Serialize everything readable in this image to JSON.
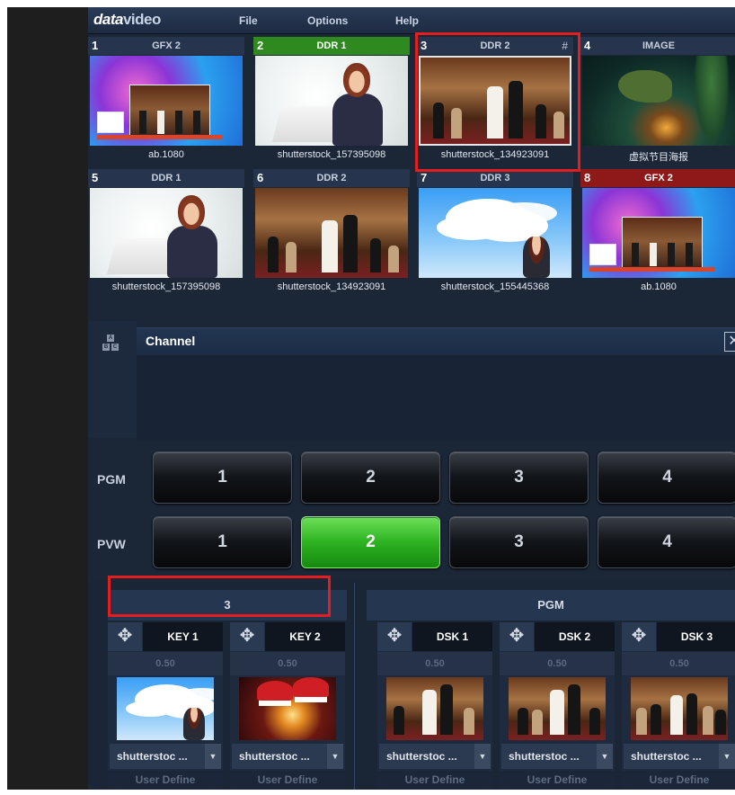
{
  "app": {
    "logo_main": "data",
    "logo_bold": "video"
  },
  "menu": {
    "file": "File",
    "options": "Options",
    "help": "Help"
  },
  "sources": [
    {
      "num": "1",
      "title": "GFX 2",
      "name": "ab.1080",
      "state": "normal"
    },
    {
      "num": "2",
      "title": "DDR 1",
      "name": "shutterstock_157395098",
      "state": "preview"
    },
    {
      "num": "3",
      "title": "DDR 2",
      "name": "shutterstock_134923091",
      "state": "selected",
      "hash": "#"
    },
    {
      "num": "4",
      "title": "IMAGE",
      "name": "虚拟节目海报",
      "state": "normal"
    },
    {
      "num": "5",
      "title": "DDR 1",
      "name": "shutterstock_157395098",
      "state": "normal"
    },
    {
      "num": "6",
      "title": "DDR 2",
      "name": "shutterstock_134923091",
      "state": "normal"
    },
    {
      "num": "7",
      "title": "DDR 3",
      "name": "shutterstock_155445368",
      "state": "normal"
    },
    {
      "num": "8",
      "title": "GFX 2",
      "name": "ab.1080",
      "state": "program"
    }
  ],
  "abc_icon": {
    "a": "A",
    "b": "B",
    "c": "C"
  },
  "channel": {
    "title": "Channel",
    "close_glyph": "✕"
  },
  "pgm": {
    "label": "PGM",
    "buttons": [
      "1",
      "2",
      "3",
      "4"
    ],
    "active": null
  },
  "pvw": {
    "label": "PVW",
    "buttons": [
      "1",
      "2",
      "3",
      "4"
    ],
    "active": "2"
  },
  "overlay_left": {
    "header": "3"
  },
  "overlay_right": {
    "header": "PGM"
  },
  "keys": [
    {
      "name": "KEY 1",
      "value": "0.50",
      "source": "shutterstoc ...",
      "user": "User Define"
    },
    {
      "name": "KEY 2",
      "value": "0.50",
      "source": "shutterstoc ...",
      "user": "User Define"
    },
    {
      "name": "DSK 1",
      "value": "0.50",
      "source": "shutterstoc ...",
      "user": "User Define"
    },
    {
      "name": "DSK 2",
      "value": "0.50",
      "source": "shutterstoc ...",
      "user": "User Define"
    },
    {
      "name": "DSK 3",
      "value": "0.50",
      "source": "shutterstoc ...",
      "user": "User Define"
    }
  ],
  "icons": {
    "move": "move-arrows-icon",
    "caret": "caret-down-icon",
    "close": "close-icon",
    "abc": "abc-layers-icon"
  },
  "colors": {
    "active_green": "#2fb422",
    "program_red": "#8d1919",
    "preview_green": "#2e8a1e",
    "annotation_red": "#e41e1e"
  }
}
